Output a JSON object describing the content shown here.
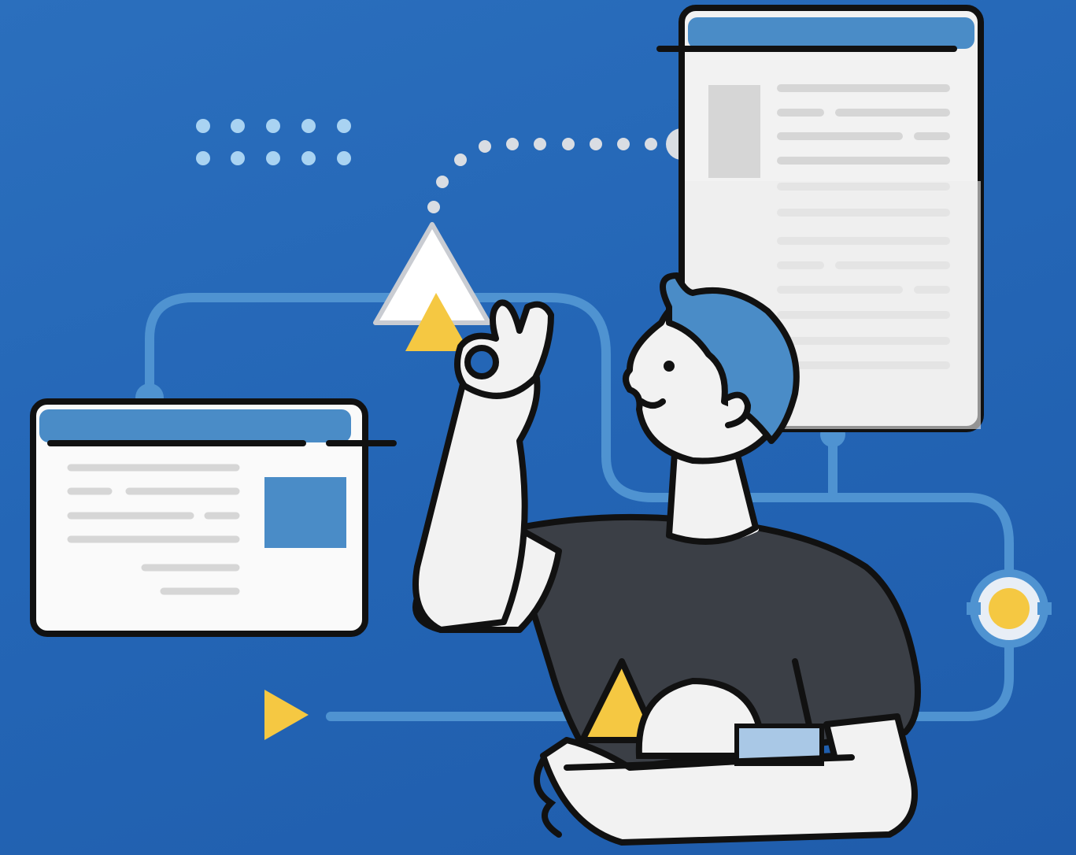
{
  "scene": {
    "description_free": true,
    "colors": {
      "background_top": "#2b6fbd",
      "background_bottom": "#1f5cab",
      "window_header": "#4a8cc7",
      "window_body": "#f4f4f4",
      "text_line": "#d6d6d6",
      "accent_yellow": "#f5c842",
      "outline": "#111111",
      "shirt": "#3b3f46",
      "hair": "#4a8cc7",
      "connector": "#4f93d1",
      "dots": "#a9d3f2"
    },
    "icons": [
      "browser-window-icon",
      "document-window-icon",
      "triangle-icon",
      "play-icon",
      "circle-node-icon",
      "dots-grid-icon"
    ]
  }
}
